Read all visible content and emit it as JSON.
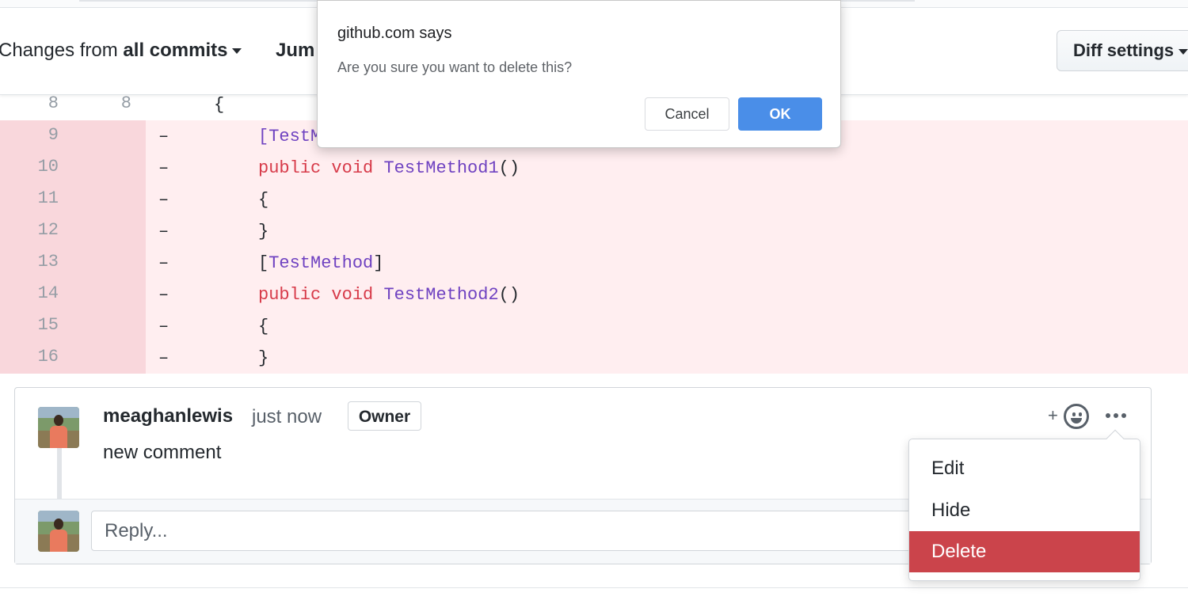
{
  "toolbar": {
    "changes_prefix": "Changes from",
    "changes_value": "all commits",
    "jump_label": "Jum",
    "diff_settings_label": "Diff settings"
  },
  "diff": {
    "context_row": {
      "old": "8",
      "new": "8",
      "code": "{"
    },
    "deleted_rows": [
      {
        "old": "9",
        "mark": "–",
        "code": "[TestM"
      },
      {
        "old": "10",
        "mark": "–",
        "kw": "public void",
        "fn": "TestMethod1",
        "rest": "()"
      },
      {
        "old": "11",
        "mark": "–",
        "code": "{"
      },
      {
        "old": "12",
        "mark": "–",
        "code": "}"
      },
      {
        "old": "13",
        "mark": "–",
        "open": "[",
        "fn": "TestMethod",
        "close": "]"
      },
      {
        "old": "14",
        "mark": "–",
        "kw": "public void",
        "fn": "TestMethod2",
        "rest": "()"
      },
      {
        "old": "15",
        "mark": "–",
        "code": "{"
      },
      {
        "old": "16",
        "mark": "–",
        "code": "}"
      }
    ]
  },
  "comment": {
    "author": "meaghanlewis",
    "timestamp": "just now",
    "badge": "Owner",
    "body": "new comment",
    "reply_placeholder": "Reply...",
    "reaction_plus": "+"
  },
  "menu": {
    "items": [
      "Edit",
      "Hide",
      "Delete"
    ]
  },
  "dialog": {
    "title": "github.com says",
    "message": "Are you sure you want to delete this?",
    "cancel": "Cancel",
    "ok": "OK"
  },
  "colors": {
    "delete_accent": "#cb444b",
    "ok_button": "#4a8ee8",
    "deleted_line_bg": "#ffeef0",
    "deleted_number_bg": "#f9d7dc"
  }
}
